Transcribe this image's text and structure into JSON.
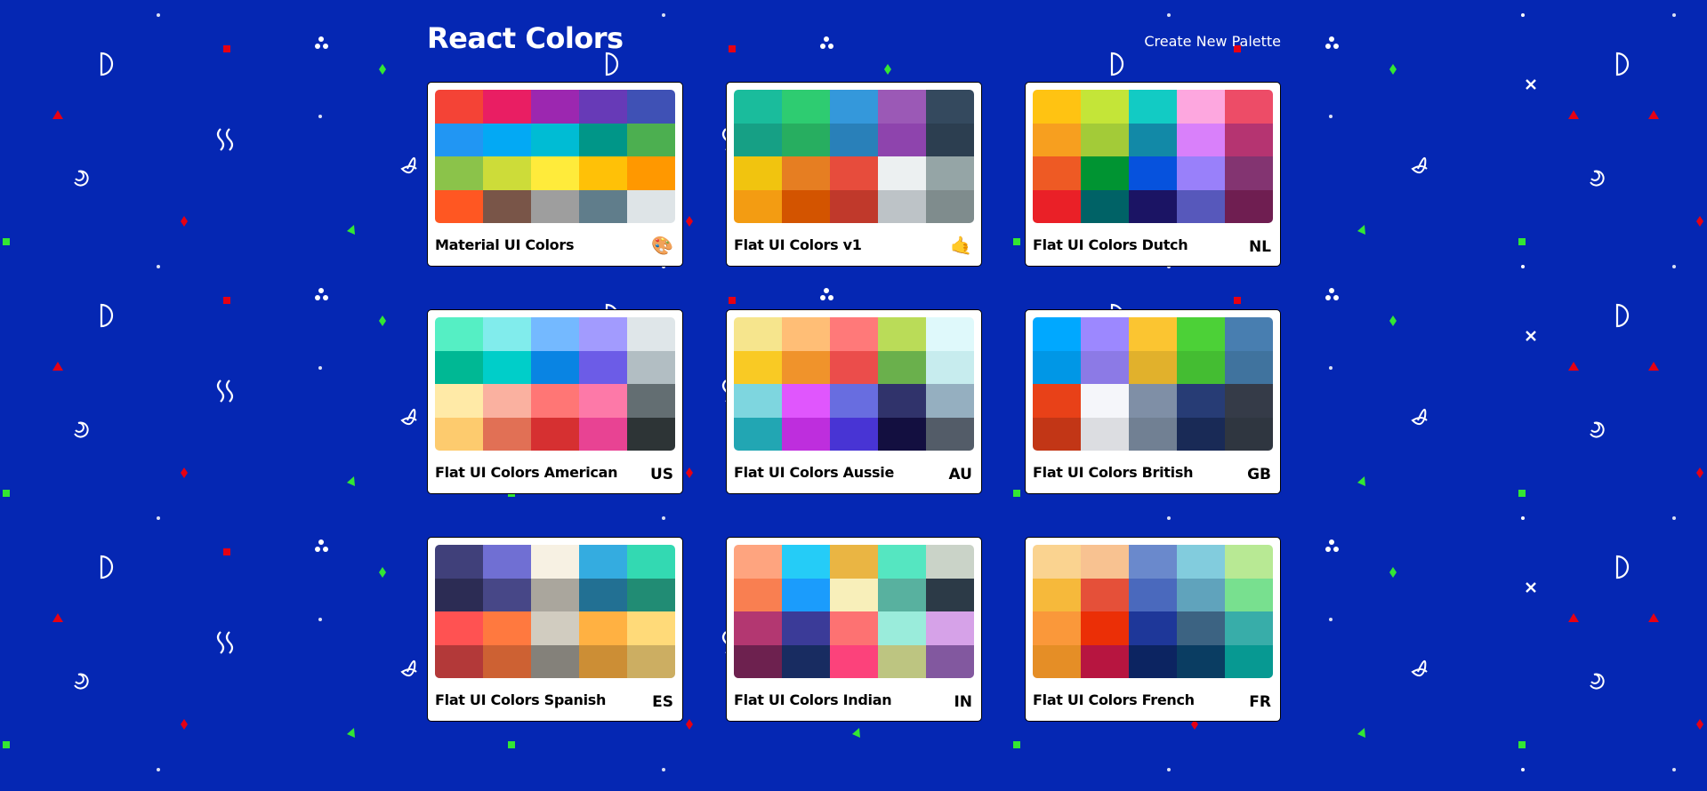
{
  "header": {
    "title": "React Colors",
    "create_link": "Create New Palette"
  },
  "background": {
    "color": "#0527b3",
    "pattern_colors": {
      "white": "#ffffff",
      "red": "#e60013",
      "green": "#33e633"
    }
  },
  "palettes": [
    {
      "name": "Material UI Colors",
      "emoji": "🎨",
      "emoji_icon": "palette-icon",
      "colors": [
        "#F44336",
        "#E91E63",
        "#9C27B0",
        "#673AB7",
        "#3F51B5",
        "#2196F3",
        "#03A9F4",
        "#00BCD4",
        "#009688",
        "#4CAF50",
        "#8BC34A",
        "#CDDC39",
        "#FFEB3B",
        "#FFC107",
        "#FF9800",
        "#FF5722",
        "#795548",
        "#9E9E9E",
        "#607D8B",
        "#DEE4E7"
      ]
    },
    {
      "name": "Flat UI Colors v1",
      "emoji": "🤙",
      "emoji_icon": "call-me-hand-icon",
      "colors": [
        "#1abc9c",
        "#2ecc71",
        "#3498db",
        "#9b59b6",
        "#34495e",
        "#16a085",
        "#27ae60",
        "#2980b9",
        "#8e44ad",
        "#2c3e50",
        "#f1c40f",
        "#e67e22",
        "#e74c3c",
        "#ecf0f1",
        "#95a5a6",
        "#f39c12",
        "#d35400",
        "#c0392b",
        "#bdc3c7",
        "#7f8c8d"
      ]
    },
    {
      "name": "Flat UI Colors Dutch",
      "emoji": "NL",
      "colors": [
        "#FFC312",
        "#C4E538",
        "#12CBC4",
        "#FDA7DF",
        "#ED4C67",
        "#F79F1F",
        "#A3CB38",
        "#1289A7",
        "#D980FA",
        "#B53471",
        "#EE5A24",
        "#009432",
        "#0652DD",
        "#9980FA",
        "#833471",
        "#EA2027",
        "#006266",
        "#1B1464",
        "#5758BB",
        "#6F1E51"
      ]
    },
    {
      "name": "Flat UI Colors American",
      "emoji": "US",
      "colors": [
        "#55efc4",
        "#81ecec",
        "#74b9ff",
        "#a29bfe",
        "#dfe6e9",
        "#00b894",
        "#00cec9",
        "#0984e3",
        "#6c5ce7",
        "#b2bec3",
        "#ffeaa7",
        "#fab1a0",
        "#ff7675",
        "#fd79a8",
        "#636e72",
        "#fdcb6e",
        "#e17055",
        "#d63031",
        "#e84393",
        "#2d3436"
      ]
    },
    {
      "name": "Flat UI Colors Aussie",
      "emoji": "AU",
      "colors": [
        "#f6e58d",
        "#ffbe76",
        "#ff7979",
        "#badc58",
        "#dff9fb",
        "#f9ca24",
        "#f0932b",
        "#eb4d4b",
        "#6ab04c",
        "#c7ecee",
        "#7ed6df",
        "#e056fd",
        "#686de0",
        "#30336b",
        "#95afc0",
        "#22a6b3",
        "#be2edd",
        "#4834d4",
        "#130f40",
        "#535c68"
      ]
    },
    {
      "name": "Flat UI Colors British",
      "emoji": "GB",
      "colors": [
        "#00a8ff",
        "#9c88ff",
        "#fbc531",
        "#4cd137",
        "#487eb0",
        "#0097e6",
        "#8c7ae6",
        "#e1b12c",
        "#44bd32",
        "#40739e",
        "#e84118",
        "#f5f6fa",
        "#7f8fa6",
        "#273c75",
        "#353b48",
        "#c23616",
        "#dcdde1",
        "#718093",
        "#192a56",
        "#2f3640"
      ]
    },
    {
      "name": "Flat UI Colors Spanish",
      "emoji": "ES",
      "colors": [
        "#40407a",
        "#706fd3",
        "#f7f1e3",
        "#34ace0",
        "#33d9b2",
        "#2c2c54",
        "#474787",
        "#aaa69d",
        "#227093",
        "#218c74",
        "#ff5252",
        "#ff793f",
        "#d1ccc0",
        "#ffb142",
        "#ffda79",
        "#b33939",
        "#cd6133",
        "#84817a",
        "#cc8e35",
        "#ccae62"
      ]
    },
    {
      "name": "Flat UI Colors Indian",
      "emoji": "IN",
      "colors": [
        "#FEA47F",
        "#25CCF7",
        "#EAB543",
        "#55E6C1",
        "#CAD3C8",
        "#F97F51",
        "#1B9CFC",
        "#F8EFBA",
        "#58B19F",
        "#2C3A47",
        "#B33771",
        "#3B3B98",
        "#FD7272",
        "#9AECDB",
        "#D6A2E8",
        "#6D214F",
        "#182C61",
        "#FC427B",
        "#BDC581",
        "#82589F"
      ]
    },
    {
      "name": "Flat UI Colors French",
      "emoji": "FR",
      "colors": [
        "#fad390",
        "#f8c291",
        "#6a89cc",
        "#82ccdd",
        "#b8e994",
        "#f6b93b",
        "#e55039",
        "#4a69bd",
        "#60a3bc",
        "#78e08f",
        "#fa983a",
        "#eb2f06",
        "#1e3799",
        "#3c6382",
        "#38ada9",
        "#e58e26",
        "#b71540",
        "#0c2461",
        "#0a3d62",
        "#079992"
      ]
    }
  ]
}
